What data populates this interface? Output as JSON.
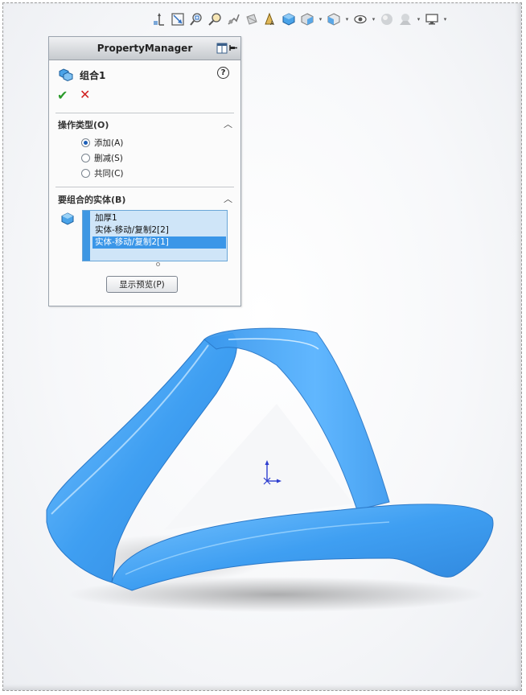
{
  "property_manager": {
    "title": "PropertyManager",
    "feature_name": "组合1",
    "help_symbol": "?",
    "ok_symbol": "✔",
    "cancel_symbol": "✕",
    "operation_section": {
      "title": "操作类型(O)",
      "options": [
        {
          "label": "添加(A)",
          "selected": true
        },
        {
          "label": "删减(S)",
          "selected": false
        },
        {
          "label": "共同(C)",
          "selected": false
        }
      ]
    },
    "bodies_section": {
      "title": "要组合的实体(B)",
      "items": [
        {
          "label": "加厚1",
          "selected": false
        },
        {
          "label": "实体-移动/复制2[2]",
          "selected": false
        },
        {
          "label": "实体-移动/复制2[1]",
          "selected": true
        }
      ]
    },
    "preview_button": "显示预览(P)",
    "chevron_symbol": "︿"
  },
  "toolbar": {
    "icons": [
      "view-orientation-icon",
      "zoom-to-fit-icon",
      "zoom-to-area-icon",
      "zoom-in-out-icon",
      "section-view-icon",
      "previous-view-icon",
      "dynamic-annotation-icon",
      "display-style-icon",
      "hide-show-icon",
      "view-type-icon",
      "visibility-icon",
      "appearance-icon",
      "scene-icon",
      "view-settings-icon"
    ]
  },
  "colors": {
    "model_blue": "#3f9ff2",
    "model_highlight": "#8fd0ff",
    "list_selected": "#3a96e8",
    "ok_green": "#2a9a2a",
    "cancel_red": "#d02020"
  }
}
